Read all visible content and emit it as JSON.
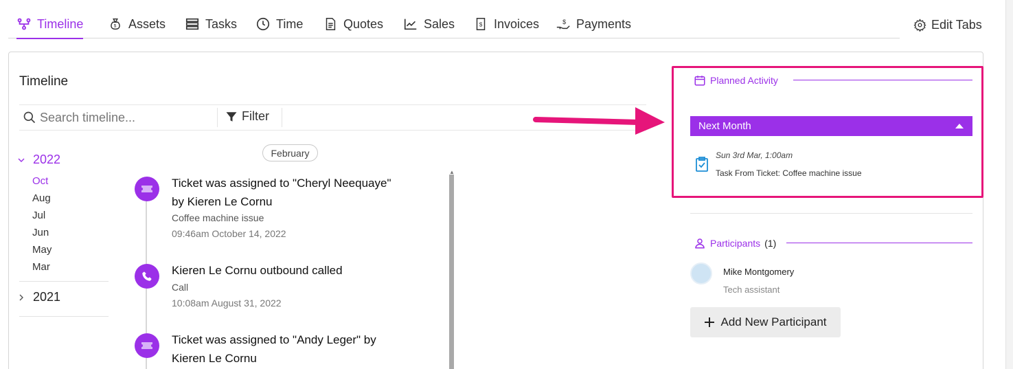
{
  "tabs": [
    {
      "label": "Timeline",
      "icon": "timeline-icon",
      "active": true
    },
    {
      "label": "Assets",
      "icon": "money-bag-icon"
    },
    {
      "label": "Tasks",
      "icon": "tasks-icon"
    },
    {
      "label": "Time",
      "icon": "clock-icon"
    },
    {
      "label": "Quotes",
      "icon": "document-icon"
    },
    {
      "label": "Sales",
      "icon": "chart-line-icon"
    },
    {
      "label": "Invoices",
      "icon": "invoice-icon"
    },
    {
      "label": "Payments",
      "icon": "payment-hand-icon"
    }
  ],
  "edit_tabs_label": "Edit Tabs",
  "timeline": {
    "title": "Timeline",
    "search_placeholder": "Search timeline...",
    "filter_label": "Filter",
    "years": [
      {
        "year": "2022",
        "expanded": true,
        "months": [
          "Oct",
          "Aug",
          "Jul",
          "Jun",
          "May",
          "Mar"
        ]
      },
      {
        "year": "2021",
        "expanded": false
      }
    ],
    "current_month_pill": "February",
    "events": [
      {
        "title": "Ticket was assigned to \"Cheryl Neequaye\" by Kieren Le Cornu",
        "subtitle": "Coffee machine issue",
        "time": "09:46am October 14, 2022",
        "icon": "ticket-icon"
      },
      {
        "title": "Kieren Le Cornu outbound called",
        "subtitle": "Call",
        "time": "10:08am August 31, 2022",
        "icon": "phone-icon"
      },
      {
        "title": "Ticket was assigned to \"Andy Leger\" by Kieren Le Cornu",
        "icon": "ticket-icon"
      }
    ]
  },
  "planned_activity": {
    "heading": "Planned Activity",
    "group_label": "Next Month",
    "task": {
      "date": "Sun 3rd Mar, 1:00am",
      "text": "Task From Ticket: Coffee machine issue"
    }
  },
  "participants": {
    "heading": "Participants",
    "count": "(1)",
    "people": [
      {
        "name": "Mike Montgomery",
        "role": "Tech assistant"
      }
    ],
    "add_label": "Add New Participant"
  },
  "colors": {
    "accent": "#9b30e8",
    "highlight": "#e6157a"
  }
}
